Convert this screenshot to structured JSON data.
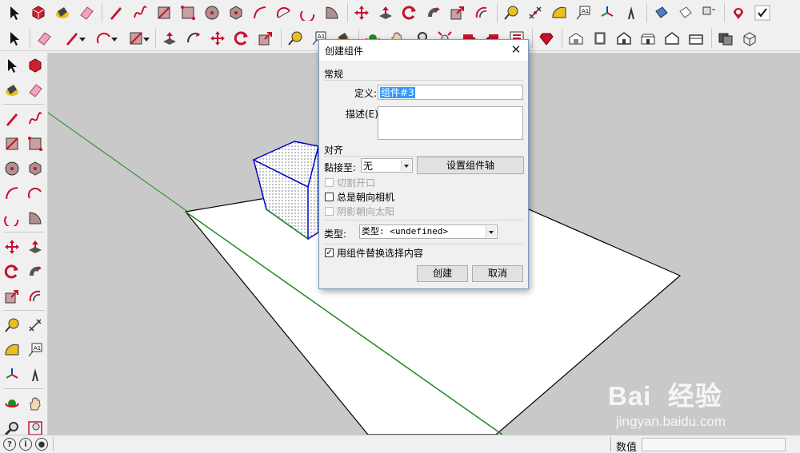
{
  "toolbar_top": {
    "icons": [
      "select-arrow-icon",
      "component-icon",
      "paint-bucket-icon",
      "eraser-icon",
      "pencil-icon",
      "freehand-icon",
      "rectangle-icon",
      "rotated-rectangle-icon",
      "circle-icon",
      "polygon-icon",
      "arc-icon",
      "two-point-arc-icon",
      "three-point-arc-icon",
      "pie-icon",
      "move-icon",
      "push-pull-icon",
      "rotate-icon",
      "follow-me-icon",
      "scale-icon",
      "offset-icon",
      "tape-measure-icon",
      "dimension-icon",
      "protractor-icon",
      "text-icon",
      "axes-icon",
      "3d-text-icon",
      "section-plane-icon",
      "section-display-icon",
      "outliner-icon",
      "warehouse-icon",
      "check-icon"
    ]
  },
  "toolbar_second": {
    "icons": [
      "select-arrow-icon",
      "eraser-icon",
      "pencil-icon",
      "arc-icon",
      "rectangle-icon",
      "push-pull-icon",
      "follow-me-icon",
      "move-icon",
      "rotate-icon",
      "scale-icon",
      "tape-measure-icon",
      "text-icon",
      "paint-bucket-icon",
      "orbit-icon",
      "pan-icon",
      "zoom-icon",
      "zoom-extents-icon",
      "previous-view-icon",
      "next-view-icon",
      "extension-icon",
      "ruby-icon",
      "iso-view-icon",
      "top-view-icon",
      "front-view-icon",
      "right-view-icon",
      "back-view-icon",
      "left-view-icon",
      "bottom-view-icon",
      "x-ray-icon",
      "wireframe-icon"
    ]
  },
  "dialog": {
    "title": "创建组件",
    "close_glyph": "✕",
    "general_group": "常规",
    "definition_label": "定义:",
    "definition_value": "组件#3",
    "description_label": "描述(E):",
    "description_value": "",
    "alignment_group": "对齐",
    "glue_label": "黏接至:",
    "glue_value": "无",
    "set_axes_button": "设置组件轴",
    "cut_opening_label": "切割开口",
    "always_face_camera_label": "总是朝向相机",
    "shadows_face_sun_label": "阴影朝向太阳",
    "type_label": "类型:",
    "type_value": "类型: <undefined>",
    "replace_selection_label": "用组件替换选择内容",
    "replace_selection_checked": "✓",
    "create_button": "创建",
    "cancel_button": "取消"
  },
  "statusbar": {
    "measurements_label": "数值",
    "measurements_value": ""
  },
  "watermark": {
    "logo_text": "Bai  经验",
    "url": "jingyan.baidu.com"
  },
  "colors": {
    "viewport_bg": "#c9c9c9",
    "selection_blue": "#0000c8",
    "axis_green": "#1f8a1f",
    "tool_red": "#c8102e"
  }
}
